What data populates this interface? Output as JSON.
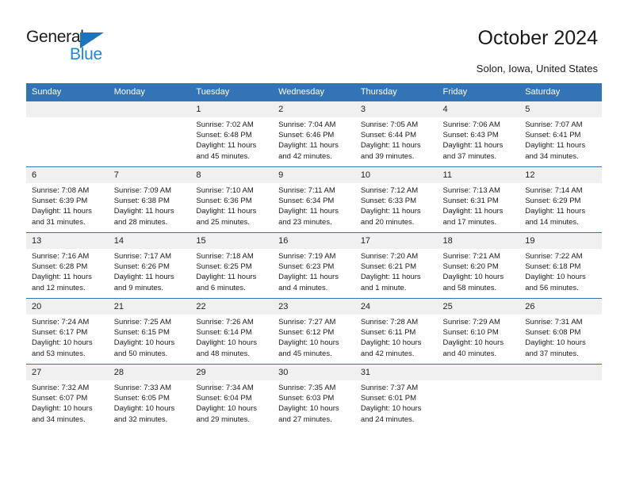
{
  "brand": {
    "name_top": "General",
    "name_bottom": "Blue",
    "triangle_color": "#1c75bc",
    "text_color": "#1c87d8"
  },
  "header": {
    "title": "October 2024",
    "location": "Solon, Iowa, United States"
  },
  "theme": {
    "header_bar": "#3274b5",
    "daynum_strip": "#f0f0f0",
    "text": "#1a1a1a"
  },
  "weekdays": [
    "Sunday",
    "Monday",
    "Tuesday",
    "Wednesday",
    "Thursday",
    "Friday",
    "Saturday"
  ],
  "labels": {
    "sunrise_prefix": "Sunrise:",
    "sunset_prefix": "Sunset:",
    "daylight_prefix": "Daylight:"
  },
  "weeks": [
    [
      {
        "day": "",
        "empty": true
      },
      {
        "day": "",
        "empty": true
      },
      {
        "day": "1",
        "sunrise": "Sunrise: 7:02 AM",
        "sunset": "Sunset: 6:48 PM",
        "daylight_line1": "Daylight: 11 hours",
        "daylight_line2": "and 45 minutes."
      },
      {
        "day": "2",
        "sunrise": "Sunrise: 7:04 AM",
        "sunset": "Sunset: 6:46 PM",
        "daylight_line1": "Daylight: 11 hours",
        "daylight_line2": "and 42 minutes."
      },
      {
        "day": "3",
        "sunrise": "Sunrise: 7:05 AM",
        "sunset": "Sunset: 6:44 PM",
        "daylight_line1": "Daylight: 11 hours",
        "daylight_line2": "and 39 minutes."
      },
      {
        "day": "4",
        "sunrise": "Sunrise: 7:06 AM",
        "sunset": "Sunset: 6:43 PM",
        "daylight_line1": "Daylight: 11 hours",
        "daylight_line2": "and 37 minutes."
      },
      {
        "day": "5",
        "sunrise": "Sunrise: 7:07 AM",
        "sunset": "Sunset: 6:41 PM",
        "daylight_line1": "Daylight: 11 hours",
        "daylight_line2": "and 34 minutes."
      }
    ],
    [
      {
        "day": "6",
        "sunrise": "Sunrise: 7:08 AM",
        "sunset": "Sunset: 6:39 PM",
        "daylight_line1": "Daylight: 11 hours",
        "daylight_line2": "and 31 minutes."
      },
      {
        "day": "7",
        "sunrise": "Sunrise: 7:09 AM",
        "sunset": "Sunset: 6:38 PM",
        "daylight_line1": "Daylight: 11 hours",
        "daylight_line2": "and 28 minutes."
      },
      {
        "day": "8",
        "sunrise": "Sunrise: 7:10 AM",
        "sunset": "Sunset: 6:36 PM",
        "daylight_line1": "Daylight: 11 hours",
        "daylight_line2": "and 25 minutes."
      },
      {
        "day": "9",
        "sunrise": "Sunrise: 7:11 AM",
        "sunset": "Sunset: 6:34 PM",
        "daylight_line1": "Daylight: 11 hours",
        "daylight_line2": "and 23 minutes."
      },
      {
        "day": "10",
        "sunrise": "Sunrise: 7:12 AM",
        "sunset": "Sunset: 6:33 PM",
        "daylight_line1": "Daylight: 11 hours",
        "daylight_line2": "and 20 minutes."
      },
      {
        "day": "11",
        "sunrise": "Sunrise: 7:13 AM",
        "sunset": "Sunset: 6:31 PM",
        "daylight_line1": "Daylight: 11 hours",
        "daylight_line2": "and 17 minutes."
      },
      {
        "day": "12",
        "sunrise": "Sunrise: 7:14 AM",
        "sunset": "Sunset: 6:29 PM",
        "daylight_line1": "Daylight: 11 hours",
        "daylight_line2": "and 14 minutes."
      }
    ],
    [
      {
        "day": "13",
        "sunrise": "Sunrise: 7:16 AM",
        "sunset": "Sunset: 6:28 PM",
        "daylight_line1": "Daylight: 11 hours",
        "daylight_line2": "and 12 minutes."
      },
      {
        "day": "14",
        "sunrise": "Sunrise: 7:17 AM",
        "sunset": "Sunset: 6:26 PM",
        "daylight_line1": "Daylight: 11 hours",
        "daylight_line2": "and 9 minutes."
      },
      {
        "day": "15",
        "sunrise": "Sunrise: 7:18 AM",
        "sunset": "Sunset: 6:25 PM",
        "daylight_line1": "Daylight: 11 hours",
        "daylight_line2": "and 6 minutes."
      },
      {
        "day": "16",
        "sunrise": "Sunrise: 7:19 AM",
        "sunset": "Sunset: 6:23 PM",
        "daylight_line1": "Daylight: 11 hours",
        "daylight_line2": "and 4 minutes."
      },
      {
        "day": "17",
        "sunrise": "Sunrise: 7:20 AM",
        "sunset": "Sunset: 6:21 PM",
        "daylight_line1": "Daylight: 11 hours",
        "daylight_line2": "and 1 minute."
      },
      {
        "day": "18",
        "sunrise": "Sunrise: 7:21 AM",
        "sunset": "Sunset: 6:20 PM",
        "daylight_line1": "Daylight: 10 hours",
        "daylight_line2": "and 58 minutes."
      },
      {
        "day": "19",
        "sunrise": "Sunrise: 7:22 AM",
        "sunset": "Sunset: 6:18 PM",
        "daylight_line1": "Daylight: 10 hours",
        "daylight_line2": "and 56 minutes."
      }
    ],
    [
      {
        "day": "20",
        "sunrise": "Sunrise: 7:24 AM",
        "sunset": "Sunset: 6:17 PM",
        "daylight_line1": "Daylight: 10 hours",
        "daylight_line2": "and 53 minutes."
      },
      {
        "day": "21",
        "sunrise": "Sunrise: 7:25 AM",
        "sunset": "Sunset: 6:15 PM",
        "daylight_line1": "Daylight: 10 hours",
        "daylight_line2": "and 50 minutes."
      },
      {
        "day": "22",
        "sunrise": "Sunrise: 7:26 AM",
        "sunset": "Sunset: 6:14 PM",
        "daylight_line1": "Daylight: 10 hours",
        "daylight_line2": "and 48 minutes."
      },
      {
        "day": "23",
        "sunrise": "Sunrise: 7:27 AM",
        "sunset": "Sunset: 6:12 PM",
        "daylight_line1": "Daylight: 10 hours",
        "daylight_line2": "and 45 minutes."
      },
      {
        "day": "24",
        "sunrise": "Sunrise: 7:28 AM",
        "sunset": "Sunset: 6:11 PM",
        "daylight_line1": "Daylight: 10 hours",
        "daylight_line2": "and 42 minutes."
      },
      {
        "day": "25",
        "sunrise": "Sunrise: 7:29 AM",
        "sunset": "Sunset: 6:10 PM",
        "daylight_line1": "Daylight: 10 hours",
        "daylight_line2": "and 40 minutes."
      },
      {
        "day": "26",
        "sunrise": "Sunrise: 7:31 AM",
        "sunset": "Sunset: 6:08 PM",
        "daylight_line1": "Daylight: 10 hours",
        "daylight_line2": "and 37 minutes."
      }
    ],
    [
      {
        "day": "27",
        "sunrise": "Sunrise: 7:32 AM",
        "sunset": "Sunset: 6:07 PM",
        "daylight_line1": "Daylight: 10 hours",
        "daylight_line2": "and 34 minutes."
      },
      {
        "day": "28",
        "sunrise": "Sunrise: 7:33 AM",
        "sunset": "Sunset: 6:05 PM",
        "daylight_line1": "Daylight: 10 hours",
        "daylight_line2": "and 32 minutes."
      },
      {
        "day": "29",
        "sunrise": "Sunrise: 7:34 AM",
        "sunset": "Sunset: 6:04 PM",
        "daylight_line1": "Daylight: 10 hours",
        "daylight_line2": "and 29 minutes."
      },
      {
        "day": "30",
        "sunrise": "Sunrise: 7:35 AM",
        "sunset": "Sunset: 6:03 PM",
        "daylight_line1": "Daylight: 10 hours",
        "daylight_line2": "and 27 minutes."
      },
      {
        "day": "31",
        "sunrise": "Sunrise: 7:37 AM",
        "sunset": "Sunset: 6:01 PM",
        "daylight_line1": "Daylight: 10 hours",
        "daylight_line2": "and 24 minutes."
      },
      {
        "day": "",
        "empty": true
      },
      {
        "day": "",
        "empty": true
      }
    ]
  ]
}
